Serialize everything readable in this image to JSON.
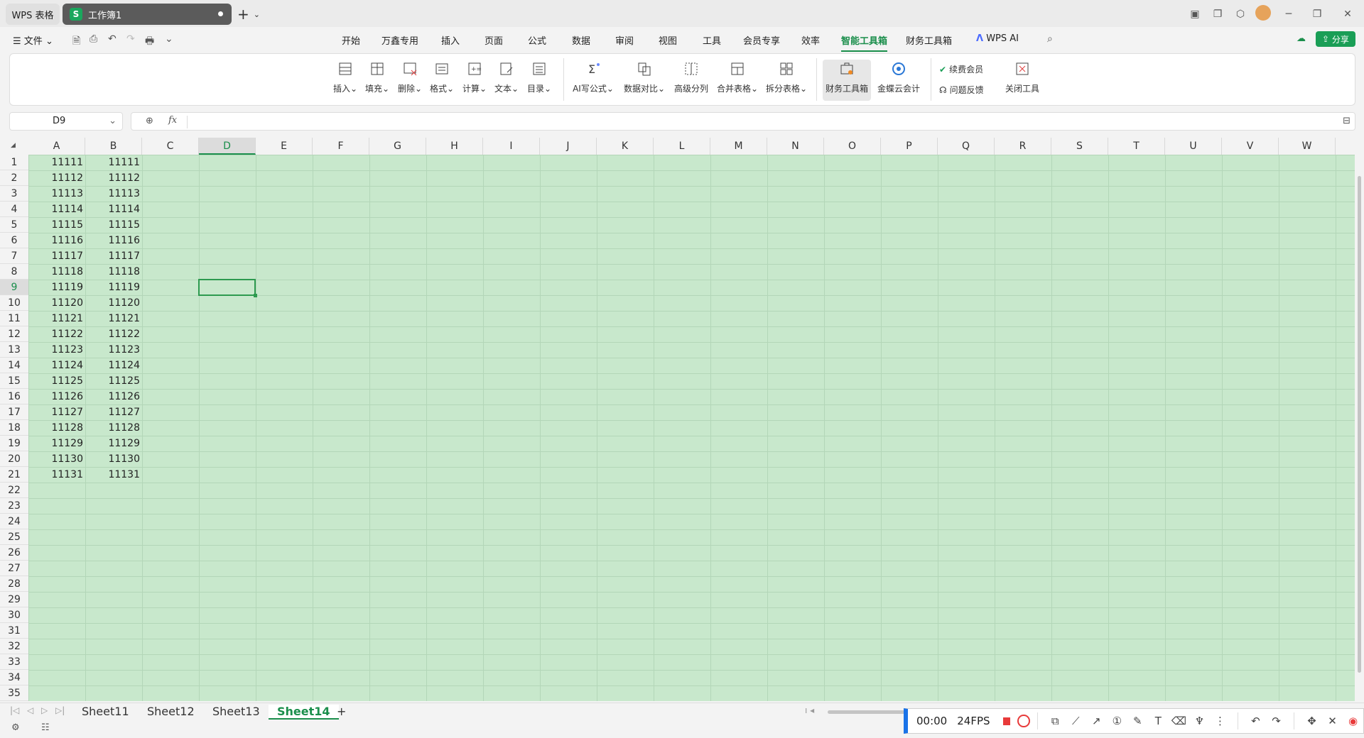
{
  "titlebar": {
    "app_tab": "WPS 表格",
    "doc_tab": "工作簿1",
    "doc_logo": "S"
  },
  "menubar": {
    "file": "文件",
    "items": [
      "开始",
      "万鑫专用",
      "插入",
      "页面",
      "公式",
      "数据",
      "审阅",
      "视图",
      "工具",
      "会员专享",
      "效率",
      "智能工具箱",
      "财务工具箱",
      "WPS AI"
    ],
    "active": "智能工具箱",
    "share": "分享"
  },
  "ribbon": {
    "tools": [
      {
        "label": "插入",
        "icon": "insert-rows-icon"
      },
      {
        "label": "填充",
        "icon": "fill-icon"
      },
      {
        "label": "删除",
        "icon": "delete-icon"
      },
      {
        "label": "格式",
        "icon": "format-icon"
      },
      {
        "label": "计算",
        "icon": "calculate-icon"
      },
      {
        "label": "文本",
        "icon": "text-icon"
      },
      {
        "label": "目录",
        "icon": "catalog-icon"
      },
      {
        "label": "AI写公式",
        "icon": "ai-formula-icon"
      },
      {
        "label": "数据对比",
        "icon": "data-compare-icon"
      },
      {
        "label": "高级分列",
        "icon": "split-column-icon"
      },
      {
        "label": "合并表格",
        "icon": "merge-table-icon"
      },
      {
        "label": "拆分表格",
        "icon": "split-table-icon"
      },
      {
        "label": "财务工具箱",
        "icon": "finance-toolbox-icon"
      },
      {
        "label": "金蝶云会计",
        "icon": "kingdee-icon"
      }
    ],
    "renew": "续费会员",
    "feedback": "问题反馈",
    "close_tool": "关闭工具"
  },
  "formula": {
    "namebox": "D9",
    "fx": "fx",
    "value": ""
  },
  "grid": {
    "columns": [
      "A",
      "B",
      "C",
      "D",
      "E",
      "F",
      "G",
      "H",
      "I",
      "J",
      "K",
      "L",
      "M",
      "N",
      "O",
      "P",
      "Q",
      "R",
      "S",
      "T",
      "U",
      "V",
      "W"
    ],
    "selected_col": "D",
    "rows": [
      "1",
      "2",
      "3",
      "4",
      "5",
      "6",
      "7",
      "8",
      "9",
      "10",
      "11",
      "12",
      "13",
      "14",
      "15",
      "16",
      "17",
      "18",
      "19",
      "20",
      "21",
      "22",
      "23",
      "24",
      "25",
      "26",
      "27",
      "28",
      "29",
      "30",
      "31",
      "32",
      "33",
      "34",
      "35"
    ],
    "selected_row": "9",
    "colA": [
      "11111",
      "11112",
      "11113",
      "11114",
      "11115",
      "11116",
      "11117",
      "11118",
      "11119",
      "11120",
      "11121",
      "11122",
      "11123",
      "11124",
      "11125",
      "11126",
      "11127",
      "11128",
      "11129",
      "11130",
      "11131"
    ],
    "colB": [
      "11111",
      "11112",
      "11113",
      "11114",
      "11115",
      "11116",
      "11117",
      "11118",
      "11119",
      "11120",
      "11121",
      "11122",
      "11123",
      "11124",
      "11125",
      "11126",
      "11127",
      "11128",
      "11129",
      "11130",
      "11131"
    ]
  },
  "sheets": {
    "tabs": [
      "Sheet11",
      "Sheet12",
      "Sheet13",
      "Sheet14"
    ],
    "active": "Sheet14",
    "add": "+"
  },
  "recorder": {
    "time": "00:00",
    "fps": "24FPS"
  },
  "colors": {
    "accent": "#1a8e4b",
    "sheet_bg": "#c8e8cc",
    "record_red": "#e83a3a"
  }
}
